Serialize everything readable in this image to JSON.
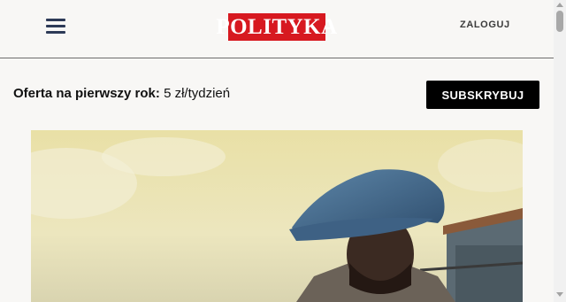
{
  "header": {
    "menu_icon": "hamburger-menu-icon",
    "logo_text": "POLITYKA",
    "login_label": "ZALOGUJ",
    "brand_color": "#d71920"
  },
  "offer": {
    "label": "Oferta na pierwszy rok:",
    "price": "5 zł/tydzień"
  },
  "subscribe": {
    "label": "SUBSKRYBUJ"
  },
  "hero": {
    "description_icon": "article-hero-photo"
  }
}
